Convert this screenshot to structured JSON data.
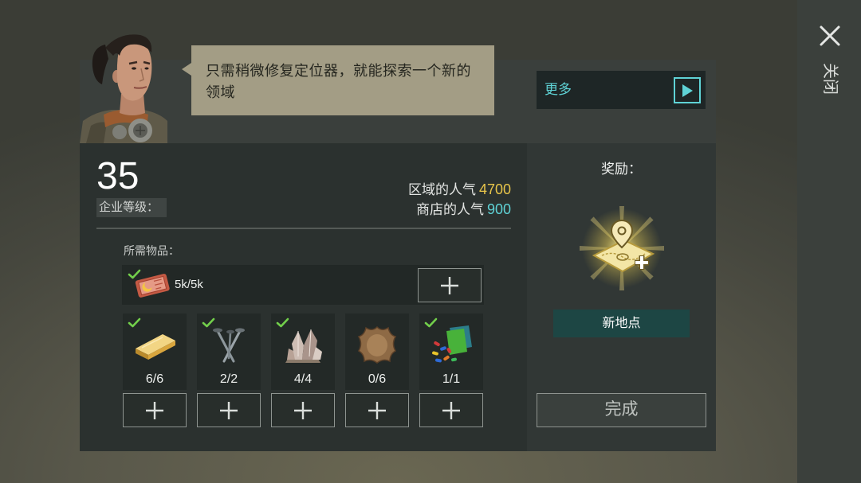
{
  "close": {
    "label": "关闭",
    "icon": "close-icon"
  },
  "dialog": {
    "text": "只需稍微修复定位器，就能探索一个新的领域",
    "portrait": "character-portrait"
  },
  "more": {
    "label": "更多",
    "icon": "play-icon"
  },
  "company": {
    "level": "35",
    "level_label": "企业等级："
  },
  "popularity": {
    "region": {
      "label": "区域的人气",
      "value": "4700"
    },
    "shop": {
      "label": "商店的人气",
      "value": "900"
    }
  },
  "requirements": {
    "title": "所需物品：",
    "add_icon": "plus-icon",
    "currency": {
      "icon": "ticket-icon",
      "amount": "5k/5k",
      "fulfilled": true
    },
    "items": [
      {
        "icon": "gold-bar-icon",
        "count": "6/6",
        "fulfilled": true
      },
      {
        "icon": "nails-icon",
        "count": "2/2",
        "fulfilled": true
      },
      {
        "icon": "crystal-icon",
        "count": "4/4",
        "fulfilled": true
      },
      {
        "icon": "leather-icon",
        "count": "0/6",
        "fulfilled": false
      },
      {
        "icon": "plastic-pieces-icon",
        "count": "1/1",
        "fulfilled": true
      }
    ]
  },
  "reward": {
    "title": "奖励：",
    "icon": "location-map-icon",
    "label": "新地点"
  },
  "complete": {
    "label": "完成"
  },
  "colors": {
    "accent": "#5fd3d6",
    "highlight": "#e8c54a",
    "check": "#72cf4b",
    "reward_button": "#1d4644"
  }
}
